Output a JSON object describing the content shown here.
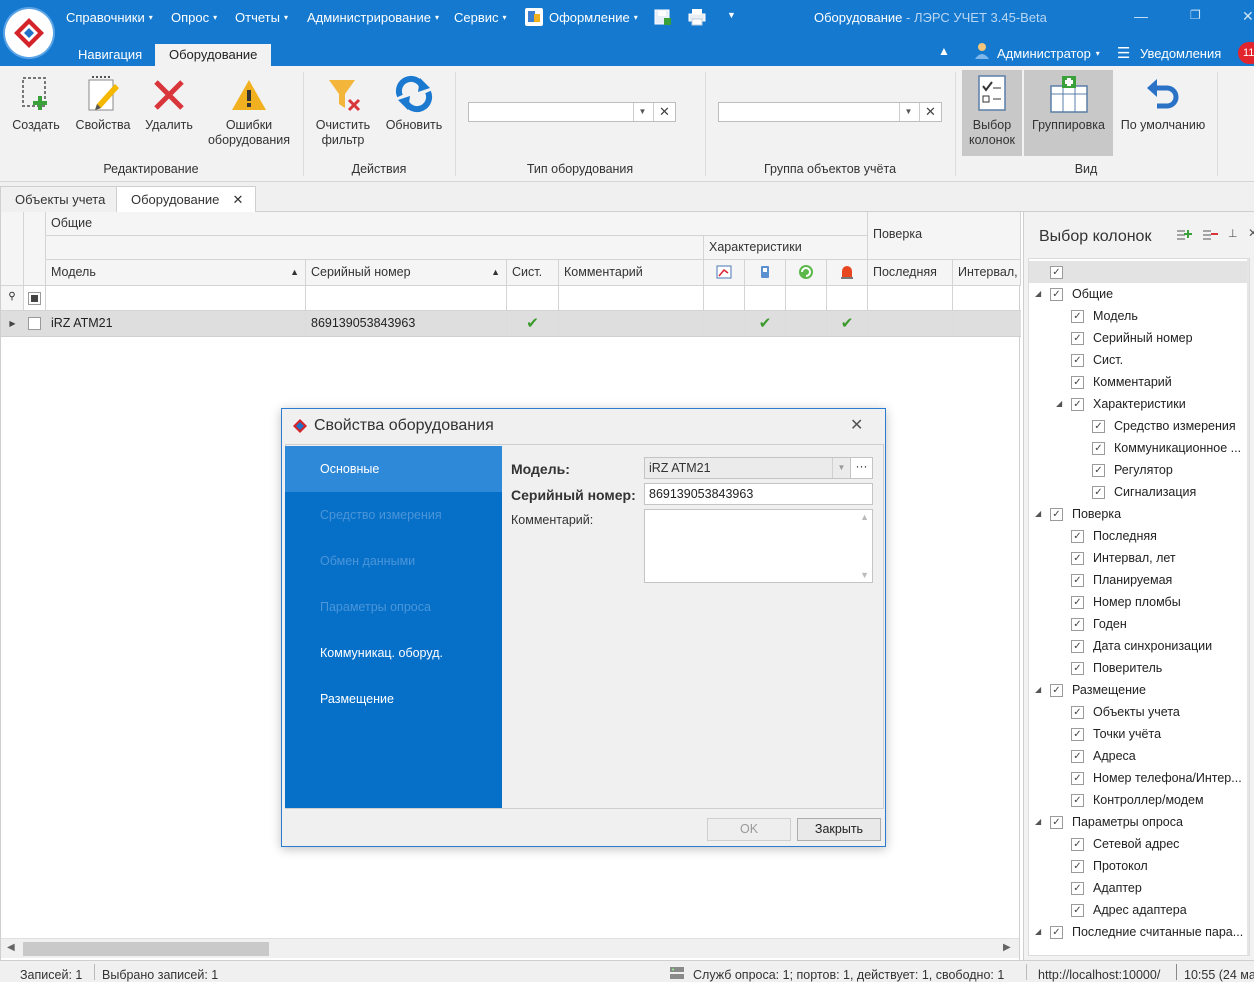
{
  "app": {
    "title": "Оборудование",
    "subtitle": " - ЛЭРС УЧЕТ 3.45-Beta",
    "notification_count": "11"
  },
  "menu": [
    "Справочники",
    "Опрос",
    "Отчеты",
    "Администрирование",
    "Сервис",
    "Оформление"
  ],
  "ribbon_tabs": [
    "Навигация",
    "Оборудование"
  ],
  "user": {
    "name": "Администратор",
    "notifications_label": "Уведомления"
  },
  "ribbon": {
    "edit": {
      "create": "Создать",
      "properties": "Свойства",
      "delete": "Удалить",
      "errors": "Ошибки оборудования",
      "group": "Редактирование"
    },
    "actions": {
      "clear_filter": "Очистить фильтр",
      "refresh": "Обновить",
      "group": "Действия"
    },
    "equipment_type": {
      "value": "",
      "group": "Тип оборудования"
    },
    "object_group": {
      "value": "",
      "group": "Группа объектов учёта"
    },
    "view": {
      "column_choice": "Выбор колонок",
      "grouping": "Группировка",
      "default": "По умолчанию",
      "group": "Вид"
    }
  },
  "doc_tabs": [
    "Объекты учета",
    "Оборудование"
  ],
  "grid": {
    "band_general": "Общие",
    "band_characteristics": "Характеристики",
    "band_verification": "Поверка",
    "columns": [
      "Модель",
      "Серийный номер",
      "Сист.",
      "Комментарий",
      "Последняя",
      "Интервал,"
    ],
    "rows": [
      {
        "model": "iRZ ATM21",
        "serial": "869139053843963",
        "system": "✔",
        "comment": "",
        "c1": "",
        "c2": "✔",
        "c3": "",
        "c4": "✔"
      }
    ]
  },
  "column_chooser": {
    "title": "Выбор колонок",
    "items": [
      {
        "label": "Общие",
        "level": 0,
        "expand": "◢"
      },
      {
        "label": "Модель",
        "level": 1
      },
      {
        "label": "Серийный номер",
        "level": 1
      },
      {
        "label": "Сист.",
        "level": 1
      },
      {
        "label": "Комментарий",
        "level": 1
      },
      {
        "label": "Характеристики",
        "level": 1,
        "expand": "◢"
      },
      {
        "label": "Средство измерения",
        "level": 2
      },
      {
        "label": "Коммуникационное ...",
        "level": 2
      },
      {
        "label": "Регулятор",
        "level": 2
      },
      {
        "label": "Сигнализация",
        "level": 2
      },
      {
        "label": "Поверка",
        "level": 0,
        "expand": "◢"
      },
      {
        "label": "Последняя",
        "level": 1
      },
      {
        "label": "Интервал, лет",
        "level": 1
      },
      {
        "label": "Планируемая",
        "level": 1
      },
      {
        "label": "Номер пломбы",
        "level": 1
      },
      {
        "label": "Годен",
        "level": 1
      },
      {
        "label": "Дата синхронизации",
        "level": 1
      },
      {
        "label": "Поверитель",
        "level": 1
      },
      {
        "label": "Размещение",
        "level": 0,
        "expand": "◢"
      },
      {
        "label": "Объекты учета",
        "level": 1
      },
      {
        "label": "Точки учёта",
        "level": 1
      },
      {
        "label": "Адреса",
        "level": 1
      },
      {
        "label": "Номер телефона/Интер...",
        "level": 1
      },
      {
        "label": "Контроллер/модем",
        "level": 1
      },
      {
        "label": "Параметры опроса",
        "level": 0,
        "expand": "◢"
      },
      {
        "label": "Сетевой адрес",
        "level": 1
      },
      {
        "label": "Протокол",
        "level": 1
      },
      {
        "label": "Адаптер",
        "level": 1
      },
      {
        "label": "Адрес адаптера",
        "level": 1
      },
      {
        "label": "Последние считанные пара...",
        "level": 0,
        "expand": "◢"
      }
    ]
  },
  "dialog": {
    "title": "Свойства оборудования",
    "nav": [
      "Основные",
      "Средство измерения",
      "Обмен данными",
      "Параметры опроса",
      "Коммуникац. оборуд.",
      "Размещение"
    ],
    "model_label": "Модель:",
    "model_value": "iRZ ATM21",
    "serial_label": "Серийный номер:",
    "serial_value": "869139053843963",
    "comment_label": "Комментарий:",
    "comment_value": "",
    "ok": "OK",
    "close": "Закрыть"
  },
  "status": {
    "records": "Записей: 1",
    "selected": "Выбрано записей: 1",
    "services": "Служб опроса: 1; портов: 1, действует: 1, свободно: 1",
    "url": "http://localhost:10000/",
    "time": "10:55 (24 ма"
  }
}
